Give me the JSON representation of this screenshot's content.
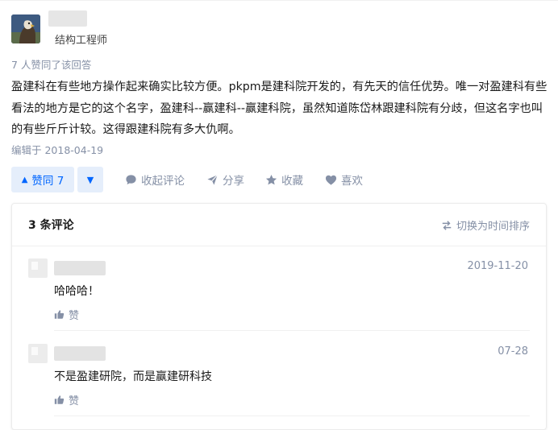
{
  "author": {
    "title": "结构工程师",
    "avatar_icon": "eagle-avatar"
  },
  "answer": {
    "votes_summary": "7 人赞同了该回答",
    "body": "盈建科在有些地方操作起来确实比较方便。pkpm是建科院开发的，有先天的信任优势。唯一对盈建科有些看法的地方是它的这个名字，盈建科--赢建科--赢建科院，虽然知道陈岱林跟建科院有分歧，但这名字也叫的有些斤斤计较。这得跟建科院有多大仇啊。",
    "edited": "编辑于 2018-04-19"
  },
  "actions": {
    "vote_up": "赞同 7",
    "collapse_comments": "收起评论",
    "share": "分享",
    "favorite": "收藏",
    "like": "喜欢"
  },
  "comments": {
    "count_label": "3 条评论",
    "sort_label": "切换为时间排序",
    "items": [
      {
        "date": "2019-11-20",
        "text": "哈哈哈！",
        "like_label": "赞"
      },
      {
        "date": "07-28",
        "text": "不是盈建研院，而是赢建研科技",
        "like_label": "赞"
      }
    ]
  },
  "colors": {
    "accent": "#0066ff",
    "vote_bg": "#e5eefb",
    "muted": "#8590a6"
  }
}
